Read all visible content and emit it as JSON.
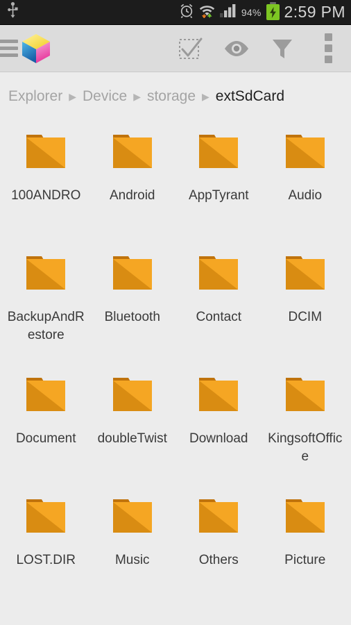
{
  "statusbar": {
    "usb_icon": "usb-icon",
    "alarm_icon": "alarm-clock-icon",
    "wifi_icon": "wifi-icon",
    "signal_icon": "signal-bars-icon",
    "battery_percent": "94%",
    "battery_icon": "battery-charging-icon",
    "clock": "2:59 PM"
  },
  "toolbar": {
    "menu_icon": "hamburger-menu-icon",
    "logo_icon": "app-cube-logo-icon",
    "select_all_icon": "select-all-checkbox-icon",
    "view_icon": "eye-visibility-icon",
    "filter_icon": "filter-funnel-icon",
    "overflow_icon": "overflow-menu-icon"
  },
  "breadcrumb": {
    "separator": "▶",
    "items": [
      {
        "label": "Explorer",
        "current": false
      },
      {
        "label": "Device",
        "current": false
      },
      {
        "label": "storage",
        "current": false
      },
      {
        "label": "extSdCard",
        "current": true
      }
    ]
  },
  "colors": {
    "statusbar_bg": "#1C1C1C",
    "toolbar_bg": "#DCDCDC",
    "content_bg": "#ECECEC",
    "folder_light": "#F5A623",
    "folder_dark": "#D98C12",
    "folder_tab": "#C0730C",
    "label_text": "#3A3A3A",
    "crumb_inactive": "#A4A4A4",
    "crumb_active": "#1F1F1F",
    "battery_green": "#7DC623"
  },
  "files": [
    {
      "name": "100ANDRO",
      "type": "folder"
    },
    {
      "name": "Android",
      "type": "folder"
    },
    {
      "name": "AppTyrant",
      "type": "folder"
    },
    {
      "name": "Audio",
      "type": "folder"
    },
    {
      "name": "BackupAndRestore",
      "type": "folder"
    },
    {
      "name": "Bluetooth",
      "type": "folder"
    },
    {
      "name": "Contact",
      "type": "folder"
    },
    {
      "name": "DCIM",
      "type": "folder"
    },
    {
      "name": "Document",
      "type": "folder"
    },
    {
      "name": "doubleTwist",
      "type": "folder"
    },
    {
      "name": "Download",
      "type": "folder"
    },
    {
      "name": "KingsoftOffice",
      "type": "folder"
    },
    {
      "name": "LOST.DIR",
      "type": "folder"
    },
    {
      "name": "Music",
      "type": "folder"
    },
    {
      "name": "Others",
      "type": "folder"
    },
    {
      "name": "Picture",
      "type": "folder"
    }
  ]
}
